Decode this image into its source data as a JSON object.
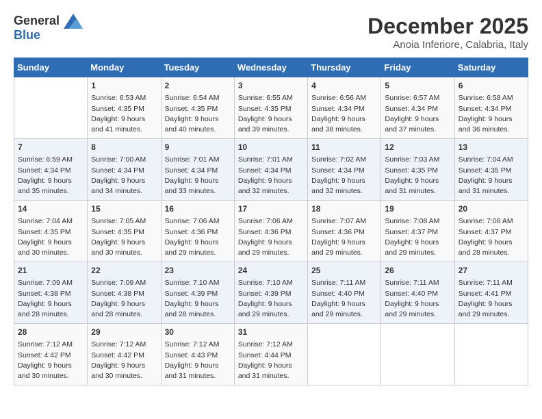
{
  "header": {
    "logo_line1": "General",
    "logo_line2": "Blue",
    "month": "December 2025",
    "location": "Anoia Inferiore, Calabria, Italy"
  },
  "days_of_week": [
    "Sunday",
    "Monday",
    "Tuesday",
    "Wednesday",
    "Thursday",
    "Friday",
    "Saturday"
  ],
  "weeks": [
    [
      {
        "day": "",
        "content": ""
      },
      {
        "day": "1",
        "content": "Sunrise: 6:53 AM\nSunset: 4:35 PM\nDaylight: 9 hours\nand 41 minutes."
      },
      {
        "day": "2",
        "content": "Sunrise: 6:54 AM\nSunset: 4:35 PM\nDaylight: 9 hours\nand 40 minutes."
      },
      {
        "day": "3",
        "content": "Sunrise: 6:55 AM\nSunset: 4:35 PM\nDaylight: 9 hours\nand 39 minutes."
      },
      {
        "day": "4",
        "content": "Sunrise: 6:56 AM\nSunset: 4:34 PM\nDaylight: 9 hours\nand 38 minutes."
      },
      {
        "day": "5",
        "content": "Sunrise: 6:57 AM\nSunset: 4:34 PM\nDaylight: 9 hours\nand 37 minutes."
      },
      {
        "day": "6",
        "content": "Sunrise: 6:58 AM\nSunset: 4:34 PM\nDaylight: 9 hours\nand 36 minutes."
      }
    ],
    [
      {
        "day": "7",
        "content": "Sunrise: 6:59 AM\nSunset: 4:34 PM\nDaylight: 9 hours\nand 35 minutes."
      },
      {
        "day": "8",
        "content": "Sunrise: 7:00 AM\nSunset: 4:34 PM\nDaylight: 9 hours\nand 34 minutes."
      },
      {
        "day": "9",
        "content": "Sunrise: 7:01 AM\nSunset: 4:34 PM\nDaylight: 9 hours\nand 33 minutes."
      },
      {
        "day": "10",
        "content": "Sunrise: 7:01 AM\nSunset: 4:34 PM\nDaylight: 9 hours\nand 32 minutes."
      },
      {
        "day": "11",
        "content": "Sunrise: 7:02 AM\nSunset: 4:34 PM\nDaylight: 9 hours\nand 32 minutes."
      },
      {
        "day": "12",
        "content": "Sunrise: 7:03 AM\nSunset: 4:35 PM\nDaylight: 9 hours\nand 31 minutes."
      },
      {
        "day": "13",
        "content": "Sunrise: 7:04 AM\nSunset: 4:35 PM\nDaylight: 9 hours\nand 31 minutes."
      }
    ],
    [
      {
        "day": "14",
        "content": "Sunrise: 7:04 AM\nSunset: 4:35 PM\nDaylight: 9 hours\nand 30 minutes."
      },
      {
        "day": "15",
        "content": "Sunrise: 7:05 AM\nSunset: 4:35 PM\nDaylight: 9 hours\nand 30 minutes."
      },
      {
        "day": "16",
        "content": "Sunrise: 7:06 AM\nSunset: 4:36 PM\nDaylight: 9 hours\nand 29 minutes."
      },
      {
        "day": "17",
        "content": "Sunrise: 7:06 AM\nSunset: 4:36 PM\nDaylight: 9 hours\nand 29 minutes."
      },
      {
        "day": "18",
        "content": "Sunrise: 7:07 AM\nSunset: 4:36 PM\nDaylight: 9 hours\nand 29 minutes."
      },
      {
        "day": "19",
        "content": "Sunrise: 7:08 AM\nSunset: 4:37 PM\nDaylight: 9 hours\nand 29 minutes."
      },
      {
        "day": "20",
        "content": "Sunrise: 7:08 AM\nSunset: 4:37 PM\nDaylight: 9 hours\nand 28 minutes."
      }
    ],
    [
      {
        "day": "21",
        "content": "Sunrise: 7:09 AM\nSunset: 4:38 PM\nDaylight: 9 hours\nand 28 minutes."
      },
      {
        "day": "22",
        "content": "Sunrise: 7:09 AM\nSunset: 4:38 PM\nDaylight: 9 hours\nand 28 minutes."
      },
      {
        "day": "23",
        "content": "Sunrise: 7:10 AM\nSunset: 4:39 PM\nDaylight: 9 hours\nand 28 minutes."
      },
      {
        "day": "24",
        "content": "Sunrise: 7:10 AM\nSunset: 4:39 PM\nDaylight: 9 hours\nand 29 minutes."
      },
      {
        "day": "25",
        "content": "Sunrise: 7:11 AM\nSunset: 4:40 PM\nDaylight: 9 hours\nand 29 minutes."
      },
      {
        "day": "26",
        "content": "Sunrise: 7:11 AM\nSunset: 4:40 PM\nDaylight: 9 hours\nand 29 minutes."
      },
      {
        "day": "27",
        "content": "Sunrise: 7:11 AM\nSunset: 4:41 PM\nDaylight: 9 hours\nand 29 minutes."
      }
    ],
    [
      {
        "day": "28",
        "content": "Sunrise: 7:12 AM\nSunset: 4:42 PM\nDaylight: 9 hours\nand 30 minutes."
      },
      {
        "day": "29",
        "content": "Sunrise: 7:12 AM\nSunset: 4:42 PM\nDaylight: 9 hours\nand 30 minutes."
      },
      {
        "day": "30",
        "content": "Sunrise: 7:12 AM\nSunset: 4:43 PM\nDaylight: 9 hours\nand 31 minutes."
      },
      {
        "day": "31",
        "content": "Sunrise: 7:12 AM\nSunset: 4:44 PM\nDaylight: 9 hours\nand 31 minutes."
      },
      {
        "day": "",
        "content": ""
      },
      {
        "day": "",
        "content": ""
      },
      {
        "day": "",
        "content": ""
      }
    ]
  ]
}
